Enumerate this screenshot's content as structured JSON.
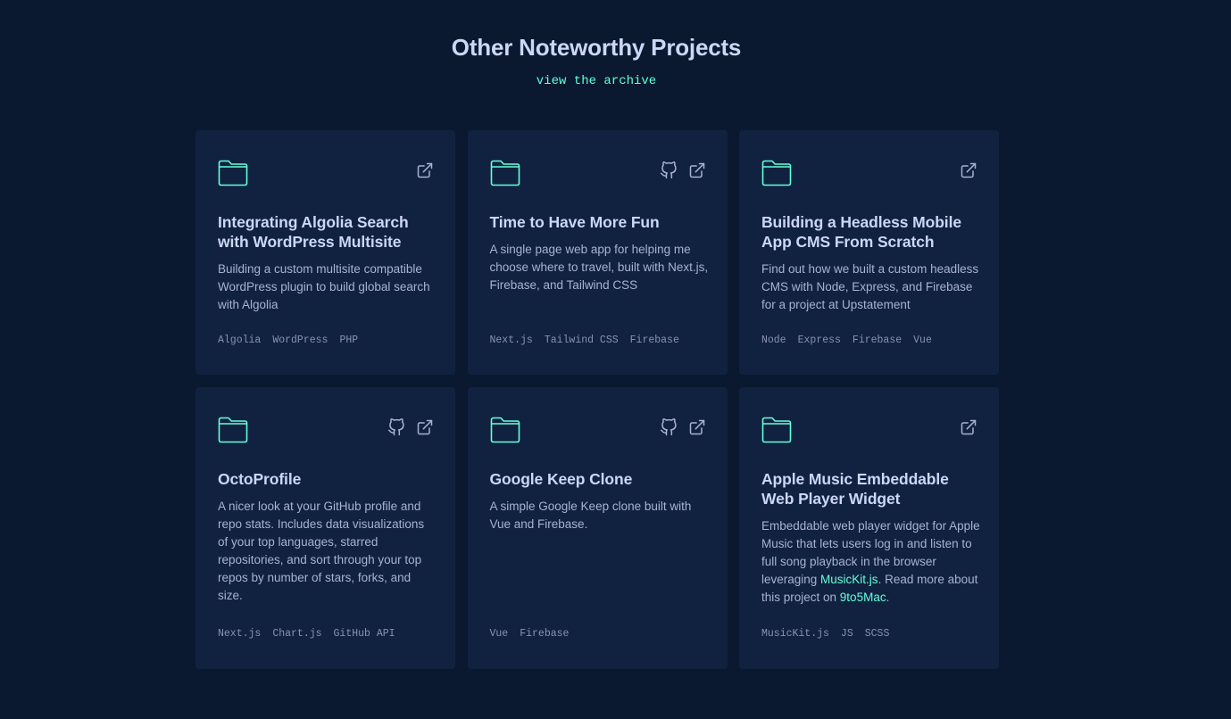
{
  "section": {
    "title": "Other Noteworthy Projects",
    "archive_link": "view the archive"
  },
  "colors": {
    "background": "#0a192f",
    "card": "#112240",
    "accent": "#64ffda",
    "heading": "#ccd6f6",
    "text": "#a8b2d1",
    "muted": "#8892b0"
  },
  "projects": [
    {
      "title": "Integrating Algolia Search with WordPress Multisite",
      "description": "Building a custom multisite compatible WordPress plugin to build global search with Algolia",
      "tech": [
        "Algolia",
        "WordPress",
        "PHP"
      ],
      "icons": [
        "folder-icon",
        "external-link-icon"
      ]
    },
    {
      "title": "Time to Have More Fun",
      "description": "A single page web app for helping me choose where to travel, built with Next.js, Firebase, and Tailwind CSS",
      "tech": [
        "Next.js",
        "Tailwind CSS",
        "Firebase"
      ],
      "icons": [
        "folder-icon",
        "github-icon",
        "external-link-icon"
      ]
    },
    {
      "title": "Building a Headless Mobile App CMS From Scratch",
      "description": "Find out how we built a custom headless CMS with Node, Express, and Firebase for a project at Upstatement",
      "tech": [
        "Node",
        "Express",
        "Firebase",
        "Vue"
      ],
      "icons": [
        "folder-icon",
        "external-link-icon"
      ]
    },
    {
      "title": "OctoProfile",
      "description": "A nicer look at your GitHub profile and repo stats. Includes data visualizations of your top languages, starred repositories, and sort through your top repos by number of stars, forks, and size.",
      "tech": [
        "Next.js",
        "Chart.js",
        "GitHub API"
      ],
      "icons": [
        "folder-icon",
        "github-icon",
        "external-link-icon"
      ]
    },
    {
      "title": "Google Keep Clone",
      "description": "A simple Google Keep clone built with Vue and Firebase.",
      "tech": [
        "Vue",
        "Firebase"
      ],
      "icons": [
        "folder-icon",
        "github-icon",
        "external-link-icon"
      ]
    },
    {
      "title": "Apple Music Embeddable Web Player Widget",
      "description_parts": {
        "before": "Embeddable web player widget for Apple Music that lets users log in and listen to full song playback in the browser leveraging ",
        "link1": "MusicKit.js",
        "middle": ". Read more about this project on ",
        "link2": "9to5Mac",
        "after": "."
      },
      "tech": [
        "MusicKit.js",
        "JS",
        "SCSS"
      ],
      "icons": [
        "folder-icon",
        "external-link-icon"
      ]
    }
  ]
}
